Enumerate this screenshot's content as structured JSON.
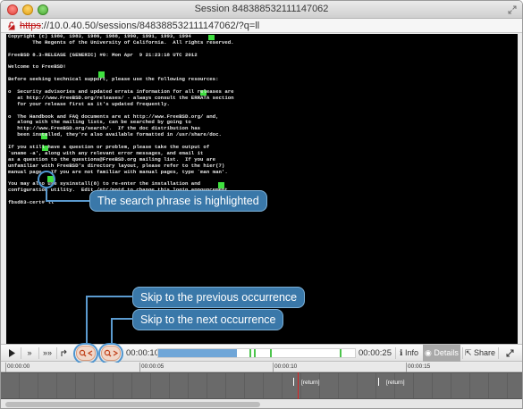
{
  "window": {
    "title": "Session 8483885321111470​62",
    "url_scheme": "https",
    "url_rest": "://10.0.40.50/sessions/848388532111147062/?q=ll"
  },
  "terminal": {
    "lines": [
      "Copyright (c) 1980, 1983, 1986, 1988, 1990, 1991, 1993, 1994",
      "        The Regents of the University of California.  All rights reserved.",
      "",
      "FreeBSD 8.3-RELEASE (GENERIC) #0: Mon Apr  9 21:23:18 UTC 2012",
      "",
      "Welcome to FreeBSD!",
      "",
      "Before seeking technical support, please use the following resources:",
      "",
      "o  Security advisories and updated errata information for all releases are",
      "   at http://www.FreeBSD.org/releases/ - always consult the ERRATA section",
      "   for your release first as it's updated frequently.",
      "",
      "o  The Handbook and FAQ documents are at http://www.FreeBSD.org/ and,",
      "   along with the mailing lists, can be searched by going to",
      "   http://www.FreeBSD.org/search/.  If the doc distribution has",
      "   been installed, they're also available formatted in /usr/share/doc.",
      "",
      "If you still have a question or problem, please take the output of",
      "`uname -a', along with any relevant error messages, and email it",
      "as a question to the questions@FreeBSD.org mailing list.  If you are",
      "unfamiliar with FreeBSD's directory layout, please refer to the hier(7)",
      "manual page.  If you are not familiar with manual pages, type `man man'.",
      "",
      "You may also use sysinstall(8) to re-enter the installation and",
      "configuration utility.  Edit /etc/motd to change this login announcement.",
      "",
      "fbsd83-cert# ll"
    ]
  },
  "callouts": {
    "search_highlight": "The search phrase is highlighted",
    "previous": "Skip to the previous occurrence",
    "next": "Skip to the next occurrence"
  },
  "player": {
    "play_icon": "play-icon",
    "fast_forward": "»",
    "faster_forward": "»»",
    "current_time": "00:00:10",
    "total_time": "00:00:25",
    "info_label": "Info",
    "details_label": "Details",
    "share_label": "Share",
    "progress": 0.4
  },
  "timeline": {
    "ruler_labels": [
      "00:00:00",
      "00:00:05",
      "00:00:10",
      "00:00:15"
    ],
    "events": [
      "[return]",
      "[return]"
    ]
  }
}
